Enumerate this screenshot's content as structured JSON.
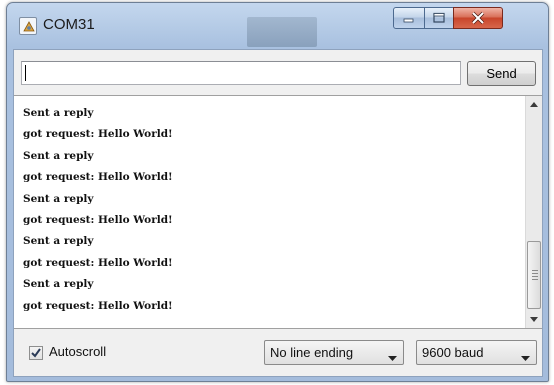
{
  "window": {
    "title": "COM31",
    "icon": "arduino-app-icon",
    "controls": {
      "minimize_icon": "minimize-icon",
      "maximize_icon": "maximize-icon",
      "close_icon": "close-icon"
    }
  },
  "send_bar": {
    "input_value": "",
    "send_label": "Send"
  },
  "console": {
    "lines": [
      "Sent a reply",
      "got request: Hello World!",
      "Sent a reply",
      "got request: Hello World!",
      "Sent a reply",
      "got request: Hello World!",
      "Sent a reply",
      "got request: Hello World!",
      "Sent a reply",
      "got request: Hello World!"
    ]
  },
  "bottom_bar": {
    "autoscroll_label": "Autoscroll",
    "autoscroll_checked": true,
    "line_ending_selected": "No line ending",
    "baud_selected": "9600 baud"
  },
  "colors": {
    "frame": "#a9c1e0",
    "close_button": "#c8452b",
    "console_bg": "#ffffff"
  }
}
